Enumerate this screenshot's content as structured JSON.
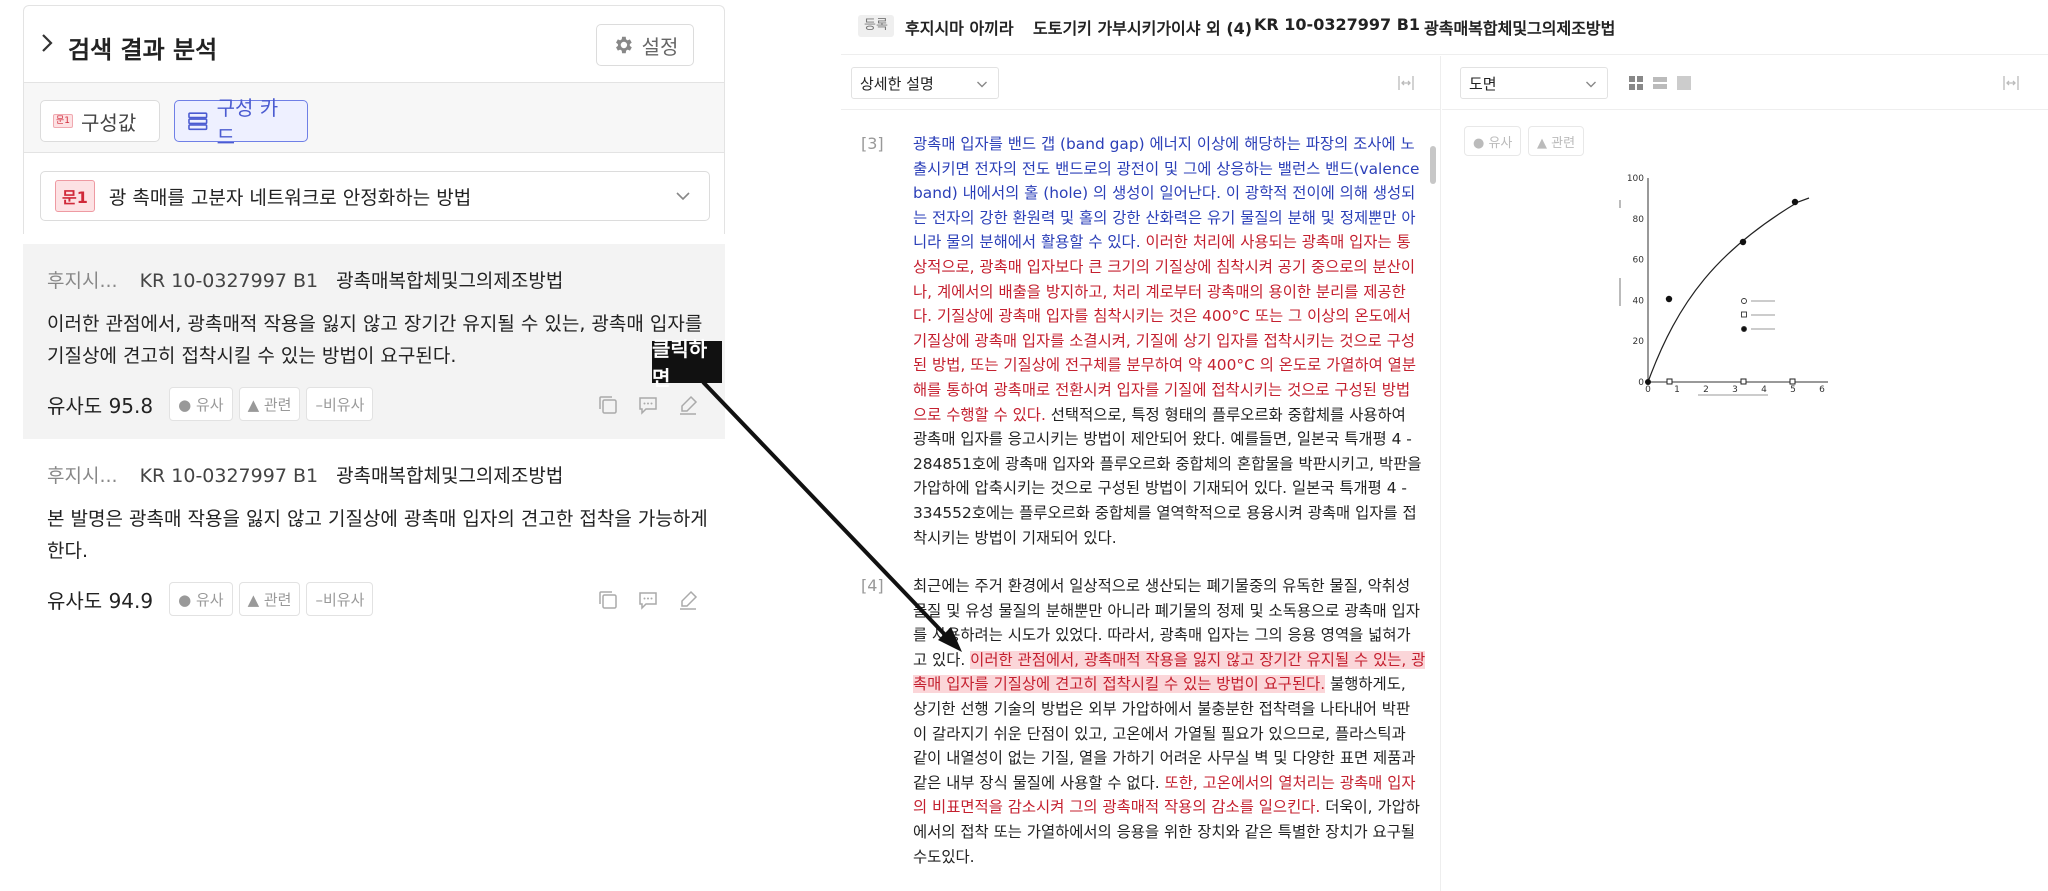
{
  "left_panel": {
    "title": "검색 결과 분석",
    "settings_label": "설정",
    "tabs": {
      "config_value": "구성값",
      "config_value_badge": "문1",
      "config_card": "구성 카드"
    },
    "question": {
      "badge": "문1",
      "text": "광 촉매를 고분자 네트워크로 안정화하는 방법"
    },
    "results": [
      {
        "author": "후지시...",
        "patent_number": "KR 10-0327997 B1",
        "title": "광촉매복합체및그의제조방법",
        "text": "이러한 관점에서, 광촉매적 작용을 잃지 않고 장기간 유지될 수 있는, 광촉매 입자를 기질상에 견고히 접착시킬 수 있는 방법이 요구된다.",
        "similarity_label": "유사도",
        "similarity": "95.8",
        "tags": [
          "● 유사",
          "▲ 관련",
          "–비유사"
        ]
      },
      {
        "author": "후지시...",
        "patent_number": "KR 10-0327997 B1",
        "title": "광촉매복합체및그의제조방법",
        "text": "본 발명은 광촉매 작용을 잃지 않고 기질상에 광촉매 입자의 견고한 접착을 가능하게 한다.",
        "similarity_label": "유사도",
        "similarity": "94.9",
        "tags": [
          "● 유사",
          "▲ 관련",
          "–비유사"
        ]
      }
    ]
  },
  "annotation": {
    "callout": "클릭하면"
  },
  "doc_header": {
    "status": "등록",
    "applicant": "후지시마 아끼라",
    "inventors": "도토기키 가부시키가이샤 외 (4)",
    "patent_number": "KR 10-0327997 B1",
    "title": "광촉매복합체및그의제조방법"
  },
  "description": {
    "select_label": "상세한 설명",
    "paragraphs": [
      {
        "num": "[3]",
        "lines": [
          [
            {
              "c": "blue",
              "t": "광촉매 입자를 밴드 갭 (band gap) 에너지 이상에 해당하는 파장의 조사에 노"
            }
          ],
          [
            {
              "c": "blue",
              "t": "출시키면 전자의 전도 밴드로의 광전이 및 그에 상응하는 밸런스 밴드(valence"
            }
          ],
          [
            {
              "c": "blue",
              "t": "band) 내에서의 홀 (hole) 의 생성이 일어난다. 이 광학적 전이에 의해 생성되"
            }
          ],
          [
            {
              "c": "blue",
              "t": "는 전자의 강한 환원력 및 홀의 강한 산화력은 유기 물질의 분해 및 정제뿐만 아"
            }
          ],
          [
            {
              "c": "blue",
              "t": "니라 물의 분해에서 활용할 수 있다. "
            },
            {
              "c": "red",
              "t": "이러한 처리에 사용되는 광촉매 입자는 통"
            }
          ],
          [
            {
              "c": "red",
              "t": "상적으로, 광촉매 입자보다 큰 크기의 기질상에 침착시켜 공기 중으로의 분산이"
            }
          ],
          [
            {
              "c": "red",
              "t": "나, 계에서의 배출을 방지하고, 처리 계로부터 광촉매의 용이한 분리를 제공한"
            }
          ],
          [
            {
              "c": "red",
              "t": "다. 기질상에 광촉매 입자를 침착시키는 것은 400°C 또는 그 이상의 온도에서"
            }
          ],
          [
            {
              "c": "red",
              "t": "기질상에 광촉매 입자를 소결시켜, 기질에 상기 입자를 접착시키는 것으로 구성"
            }
          ],
          [
            {
              "c": "red",
              "t": "된 방법, 또는 기질상에 전구체를 분무하여 약 400°C 의 온도로 가열하여 열분"
            }
          ],
          [
            {
              "c": "red",
              "t": "해를 통하여 광촉매로 전환시켜 입자를 기질에 접착시키는 것으로 구성된 방법"
            }
          ],
          [
            {
              "c": "red",
              "t": "으로 수행할 수 있다."
            },
            {
              "c": "",
              "t": " 선택적으로, 특정 형태의 플루오르화 중합체를 사용하여"
            }
          ],
          [
            {
              "c": "",
              "t": "광촉매 입자를 응고시키는 방법이 제안되어 왔다. 예를들면, 일본국 특개평 4 -"
            }
          ],
          [
            {
              "c": "",
              "t": "284851호에 광촉매 입자와 플루오르화 중합체의 혼합물을 박판시키고, 박판을"
            }
          ],
          [
            {
              "c": "",
              "t": "가압하에 압축시키는 것으로 구성된 방법이 기재되어 있다. 일본국 특개평 4 -"
            }
          ],
          [
            {
              "c": "",
              "t": "334552호에는 플루오르화 중합체를 열역학적으로 용융시켜 광촉매 입자를 접"
            }
          ],
          [
            {
              "c": "",
              "t": "착시키는 방법이 기재되어 있다."
            }
          ]
        ]
      },
      {
        "num": "[4]",
        "lines": [
          [
            {
              "c": "",
              "t": "최근에는 주거 환경에서 일상적으로 생산되는 폐기물중의 유독한 물질, 악취성"
            }
          ],
          [
            {
              "c": "",
              "t": "물질 및 유성 물질의 분해뿐만 아니라 폐기물의 정제 및 소독용으로 광촉매 입자"
            }
          ],
          [
            {
              "c": "",
              "t": "를 사용하려는 시도가 있었다. 따라서, 광촉매 입자는 그의 응용 영역을 넓혀가"
            }
          ],
          [
            {
              "c": "",
              "t": "고 있다. "
            },
            {
              "c": "hl",
              "t": "이러한 관점에서, 광촉매적 작용을 잃지 않고 장기간 유지될 수 있는, 광"
            }
          ],
          [
            {
              "c": "hl",
              "t": "촉매 입자를 기질상에 견고히 접착시킬 수 있는 방법이 요구된다."
            },
            {
              "c": "",
              "t": " 불행하게도,"
            }
          ],
          [
            {
              "c": "",
              "t": "상기한 선행 기술의 방법은 외부 가압하에서 불충분한 접착력을 나타내어 박판"
            }
          ],
          [
            {
              "c": "",
              "t": "이 갈라지기 쉬운 단점이 있고, 고온에서 가열될 필요가 있으므로, 플라스틱과"
            }
          ],
          [
            {
              "c": "",
              "t": "같이 내열성이 없는 기질, 열을 가하기 어려운 사무실 벽 및 다양한 표면 제품과"
            }
          ],
          [
            {
              "c": "",
              "t": "같은 내부 장식 물질에 사용할 수 없다. "
            },
            {
              "c": "red",
              "t": "또한, 고온에서의 열처리는 광촉매 입자"
            }
          ],
          [
            {
              "c": "red",
              "t": "의 비표면적을 감소시켜 그의 광촉매적 작용의 감소를 일으킨다."
            },
            {
              "c": "",
              "t": " 더욱이, 가압하"
            }
          ],
          [
            {
              "c": "",
              "t": "에서의 접착 또는 가열하에서의 응용을 위한 장치와 같은 특별한 장치가 요구될"
            }
          ],
          [
            {
              "c": "",
              "t": "수도있다."
            }
          ]
        ]
      }
    ]
  },
  "drawing": {
    "select_label": "도면",
    "pill_similar": "● 유사",
    "pill_related": "▲ 관련",
    "figure": {
      "y_ticks": [
        "100",
        "80",
        "60",
        "40",
        "20",
        "0"
      ],
      "x_ticks": [
        "0",
        "1",
        "2",
        "3",
        "4",
        "5",
        "6"
      ]
    }
  }
}
